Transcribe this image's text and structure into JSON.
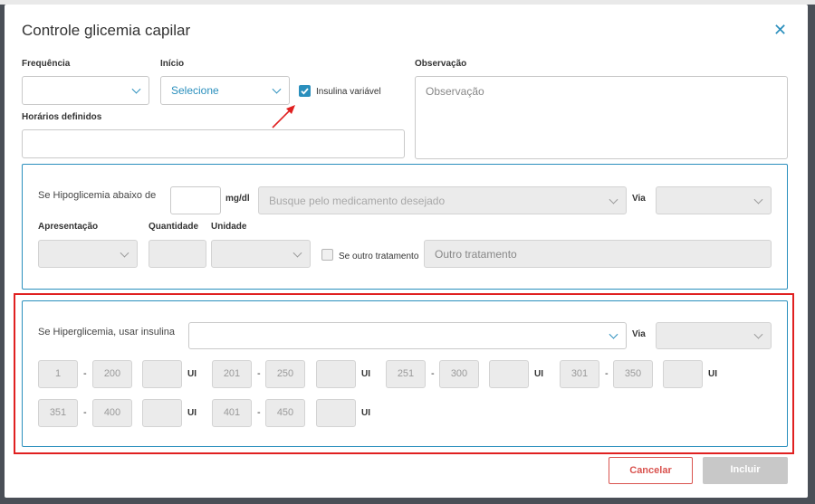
{
  "modal": {
    "title": "Controle glicemia capilar"
  },
  "top": {
    "frequencia": {
      "label": "Frequência",
      "value": ""
    },
    "inicio": {
      "label": "Início",
      "value": "Selecione"
    },
    "insulina_variavel": {
      "label": "Insulina variável",
      "checked": true
    },
    "horarios": {
      "label": "Horários definidos",
      "value": ""
    },
    "observacao": {
      "label": "Observação",
      "placeholder": "Observação"
    }
  },
  "hipo": {
    "label": "Se Hipoglicemia abaixo de",
    "unit": "mg/dl",
    "medicamento_placeholder": "Busque pelo medicamento desejado",
    "via_label": "Via",
    "apresentacao_label": "Apresentação",
    "quantidade_label": "Quantidade",
    "unidade_label": "Unidade",
    "outro_label": "Se outro tratamento",
    "outro_placeholder": "Outro tratamento"
  },
  "hiper": {
    "label": "Se Hiperglicemia, usar insulina",
    "via_label": "Via",
    "unit": "UI",
    "dash": "-",
    "ranges": [
      {
        "from": "1",
        "to": "200"
      },
      {
        "from": "201",
        "to": "250"
      },
      {
        "from": "251",
        "to": "300"
      },
      {
        "from": "301",
        "to": "350"
      },
      {
        "from": "351",
        "to": "400"
      },
      {
        "from": "401",
        "to": "450"
      }
    ]
  },
  "buttons": {
    "cancel": "Cancelar",
    "submit": "Incluir"
  },
  "colors": {
    "accent": "#2a8fbd",
    "annotation": "#e02020",
    "cancel": "#d9534f"
  }
}
